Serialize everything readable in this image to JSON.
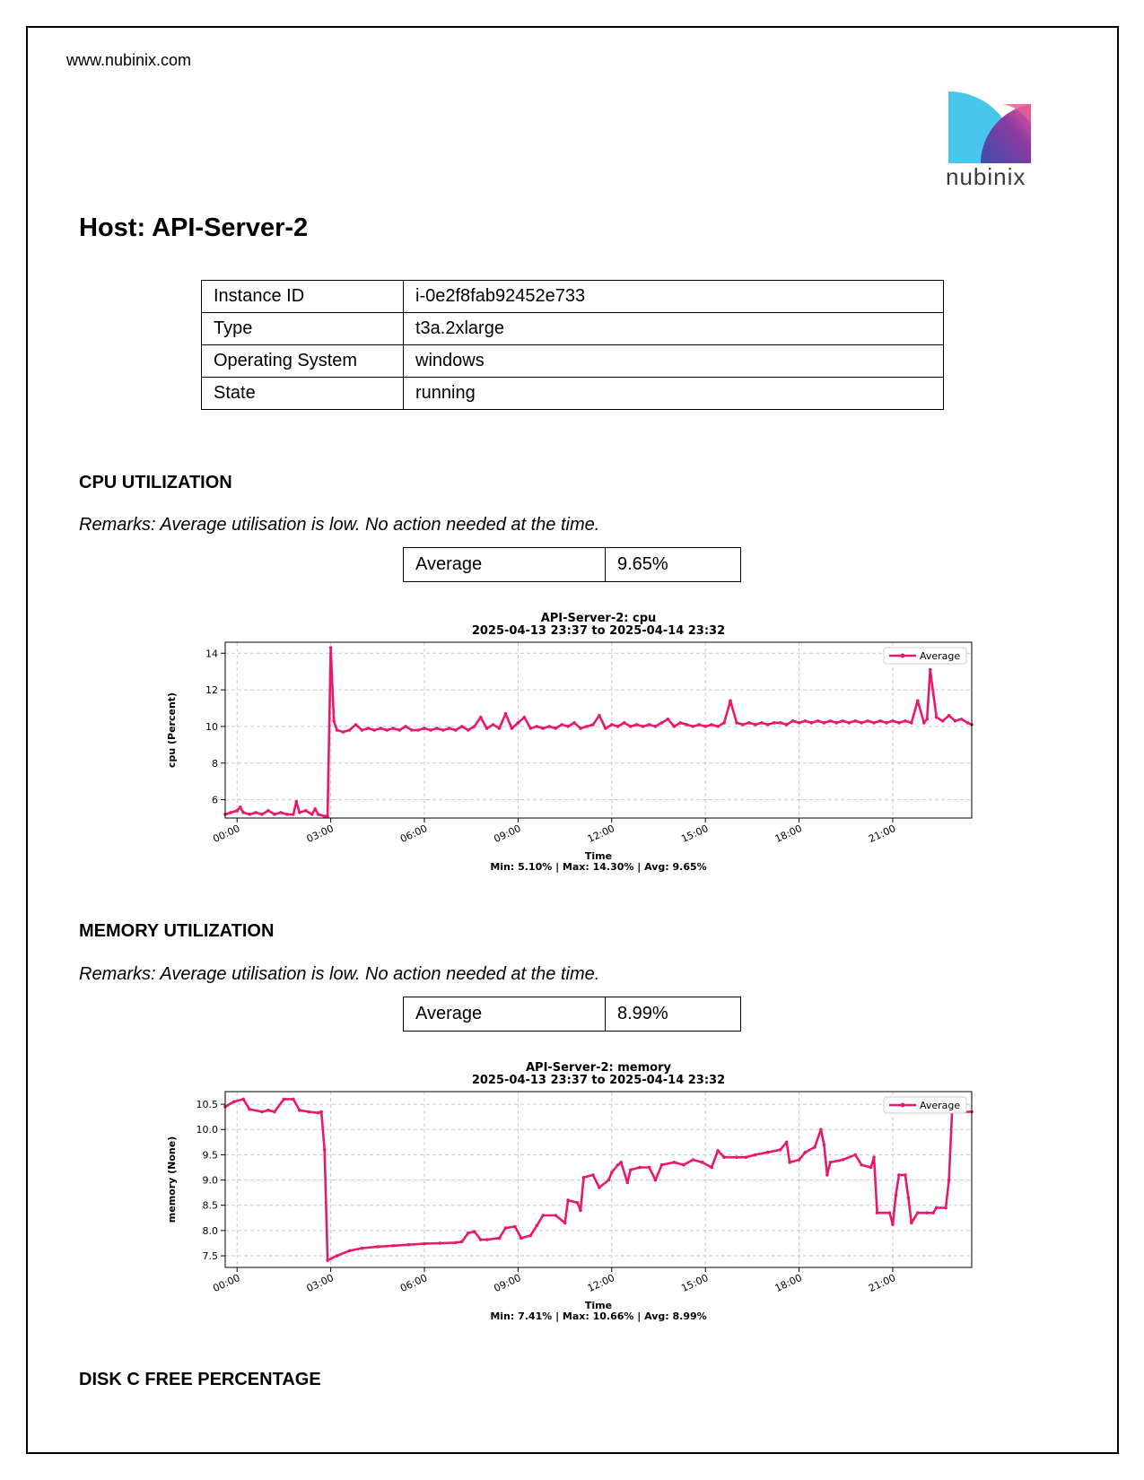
{
  "header": {
    "site": "www.nubinix.com",
    "logo_text": "nubinix"
  },
  "host": {
    "title": "Host: API-Server-2"
  },
  "info_table": [
    {
      "key": "Instance ID",
      "value": "i-0e2f8fab92452e733"
    },
    {
      "key": "Type",
      "value": "t3a.2xlarge"
    },
    {
      "key": "Operating System",
      "value": "windows"
    },
    {
      "key": "State",
      "value": "running"
    }
  ],
  "cpu": {
    "heading": "CPU UTILIZATION",
    "remarks": "Remarks: Average utilisation is low. No action needed at the time.",
    "avg_label": "Average",
    "avg_value": "9.65%"
  },
  "memory": {
    "heading": "MEMORY UTILIZATION",
    "remarks": "Remarks: Average utilisation is low. No action needed at the time.",
    "avg_label": "Average",
    "avg_value": "8.99%"
  },
  "disk": {
    "heading": "DISK C FREE PERCENTAGE"
  },
  "chart_data": [
    {
      "type": "line",
      "title": "API-Server-2: cpu",
      "subtitle": "2025-04-13 23:37 to 2025-04-14 23:32",
      "xlabel": "Time",
      "ylabel": "cpu (Percent)",
      "footer": "Min: 5.10% | Max: 14.30% | Avg: 9.65%",
      "x_ticks": [
        "00:00",
        "03:00",
        "06:00",
        "09:00",
        "12:00",
        "15:00",
        "18:00",
        "21:00"
      ],
      "y_ticks": [
        6,
        8,
        10,
        12,
        14
      ],
      "xlim": [
        -0.38,
        23.53
      ],
      "ylim": [
        5.0,
        14.6
      ],
      "grid": true,
      "legend_position": "top-right",
      "series": [
        {
          "name": "Average",
          "color": "#e8186d",
          "points": [
            [
              -0.38,
              5.2
            ],
            [
              -0.2,
              5.3
            ],
            [
              0.0,
              5.4
            ],
            [
              0.1,
              5.6
            ],
            [
              0.2,
              5.3
            ],
            [
              0.4,
              5.2
            ],
            [
              0.6,
              5.3
            ],
            [
              0.8,
              5.2
            ],
            [
              1.0,
              5.4
            ],
            [
              1.2,
              5.2
            ],
            [
              1.4,
              5.3
            ],
            [
              1.6,
              5.2
            ],
            [
              1.8,
              5.2
            ],
            [
              1.9,
              5.9
            ],
            [
              2.0,
              5.3
            ],
            [
              2.2,
              5.4
            ],
            [
              2.4,
              5.2
            ],
            [
              2.5,
              5.5
            ],
            [
              2.6,
              5.2
            ],
            [
              2.8,
              5.1
            ],
            [
              2.9,
              5.1
            ],
            [
              3.0,
              14.3
            ],
            [
              3.1,
              10.3
            ],
            [
              3.2,
              9.8
            ],
            [
              3.4,
              9.7
            ],
            [
              3.6,
              9.8
            ],
            [
              3.8,
              10.1
            ],
            [
              4.0,
              9.8
            ],
            [
              4.2,
              9.9
            ],
            [
              4.4,
              9.8
            ],
            [
              4.6,
              9.9
            ],
            [
              4.8,
              9.8
            ],
            [
              5.0,
              9.9
            ],
            [
              5.2,
              9.8
            ],
            [
              5.4,
              10.0
            ],
            [
              5.6,
              9.8
            ],
            [
              5.8,
              9.8
            ],
            [
              6.0,
              9.9
            ],
            [
              6.2,
              9.8
            ],
            [
              6.4,
              9.9
            ],
            [
              6.6,
              9.8
            ],
            [
              6.8,
              9.9
            ],
            [
              7.0,
              9.8
            ],
            [
              7.2,
              10.0
            ],
            [
              7.4,
              9.8
            ],
            [
              7.6,
              10.0
            ],
            [
              7.8,
              10.5
            ],
            [
              8.0,
              9.9
            ],
            [
              8.2,
              10.1
            ],
            [
              8.4,
              9.9
            ],
            [
              8.6,
              10.7
            ],
            [
              8.8,
              9.9
            ],
            [
              9.0,
              10.2
            ],
            [
              9.2,
              10.5
            ],
            [
              9.4,
              9.9
            ],
            [
              9.6,
              10.0
            ],
            [
              9.8,
              9.9
            ],
            [
              10.0,
              10.0
            ],
            [
              10.2,
              9.9
            ],
            [
              10.4,
              10.1
            ],
            [
              10.6,
              10.0
            ],
            [
              10.8,
              10.2
            ],
            [
              11.0,
              9.9
            ],
            [
              11.2,
              10.0
            ],
            [
              11.4,
              10.1
            ],
            [
              11.6,
              10.6
            ],
            [
              11.8,
              9.9
            ],
            [
              12.0,
              10.1
            ],
            [
              12.2,
              10.0
            ],
            [
              12.4,
              10.2
            ],
            [
              12.6,
              10.0
            ],
            [
              12.8,
              10.1
            ],
            [
              13.0,
              10.0
            ],
            [
              13.2,
              10.1
            ],
            [
              13.4,
              10.0
            ],
            [
              13.6,
              10.2
            ],
            [
              13.8,
              10.4
            ],
            [
              14.0,
              10.0
            ],
            [
              14.2,
              10.2
            ],
            [
              14.4,
              10.1
            ],
            [
              14.6,
              10.0
            ],
            [
              14.8,
              10.1
            ],
            [
              15.0,
              10.0
            ],
            [
              15.2,
              10.1
            ],
            [
              15.4,
              10.0
            ],
            [
              15.6,
              10.2
            ],
            [
              15.8,
              11.4
            ],
            [
              16.0,
              10.2
            ],
            [
              16.2,
              10.1
            ],
            [
              16.4,
              10.2
            ],
            [
              16.6,
              10.1
            ],
            [
              16.8,
              10.2
            ],
            [
              17.0,
              10.1
            ],
            [
              17.2,
              10.2
            ],
            [
              17.4,
              10.2
            ],
            [
              17.6,
              10.1
            ],
            [
              17.8,
              10.3
            ],
            [
              18.0,
              10.2
            ],
            [
              18.2,
              10.3
            ],
            [
              18.4,
              10.2
            ],
            [
              18.6,
              10.3
            ],
            [
              18.8,
              10.2
            ],
            [
              19.0,
              10.3
            ],
            [
              19.2,
              10.2
            ],
            [
              19.4,
              10.3
            ],
            [
              19.6,
              10.2
            ],
            [
              19.8,
              10.3
            ],
            [
              20.0,
              10.2
            ],
            [
              20.2,
              10.3
            ],
            [
              20.4,
              10.2
            ],
            [
              20.6,
              10.3
            ],
            [
              20.8,
              10.2
            ],
            [
              21.0,
              10.3
            ],
            [
              21.2,
              10.2
            ],
            [
              21.4,
              10.3
            ],
            [
              21.6,
              10.2
            ],
            [
              21.8,
              11.4
            ],
            [
              22.0,
              10.2
            ],
            [
              22.1,
              10.4
            ],
            [
              22.2,
              13.1
            ],
            [
              22.4,
              10.5
            ],
            [
              22.6,
              10.3
            ],
            [
              22.8,
              10.6
            ],
            [
              23.0,
              10.3
            ],
            [
              23.2,
              10.4
            ],
            [
              23.4,
              10.2
            ],
            [
              23.53,
              10.1
            ]
          ]
        }
      ]
    },
    {
      "type": "line",
      "title": "API-Server-2: memory",
      "subtitle": "2025-04-13 23:37 to 2025-04-14 23:32",
      "xlabel": "Time",
      "ylabel": "memory (None)",
      "footer": "Min: 7.41% | Max: 10.66% | Avg: 8.99%",
      "x_ticks": [
        "00:00",
        "03:00",
        "06:00",
        "09:00",
        "12:00",
        "15:00",
        "18:00",
        "21:00"
      ],
      "y_ticks": [
        7.5,
        8.0,
        8.5,
        9.0,
        9.5,
        10.0,
        10.5
      ],
      "xlim": [
        -0.38,
        23.53
      ],
      "ylim": [
        7.27,
        10.75
      ],
      "grid": true,
      "legend_position": "top-right",
      "series": [
        {
          "name": "Average",
          "color": "#e8186d",
          "points": [
            [
              -0.38,
              10.45
            ],
            [
              -0.1,
              10.55
            ],
            [
              0.2,
              10.6
            ],
            [
              0.4,
              10.4
            ],
            [
              0.8,
              10.35
            ],
            [
              1.0,
              10.38
            ],
            [
              1.2,
              10.35
            ],
            [
              1.5,
              10.6
            ],
            [
              1.8,
              10.6
            ],
            [
              2.0,
              10.38
            ],
            [
              2.3,
              10.35
            ],
            [
              2.6,
              10.33
            ],
            [
              2.7,
              10.35
            ],
            [
              2.8,
              9.6
            ],
            [
              2.9,
              7.41
            ],
            [
              3.2,
              7.5
            ],
            [
              3.6,
              7.6
            ],
            [
              4.0,
              7.65
            ],
            [
              4.5,
              7.68
            ],
            [
              5.0,
              7.7
            ],
            [
              5.5,
              7.72
            ],
            [
              6.0,
              7.74
            ],
            [
              6.5,
              7.75
            ],
            [
              7.0,
              7.76
            ],
            [
              7.2,
              7.78
            ],
            [
              7.4,
              7.95
            ],
            [
              7.6,
              7.98
            ],
            [
              7.8,
              7.82
            ],
            [
              8.0,
              7.82
            ],
            [
              8.4,
              7.85
            ],
            [
              8.6,
              8.05
            ],
            [
              8.9,
              8.08
            ],
            [
              9.1,
              7.85
            ],
            [
              9.4,
              7.9
            ],
            [
              9.6,
              8.1
            ],
            [
              9.8,
              8.3
            ],
            [
              10.2,
              8.3
            ],
            [
              10.5,
              8.15
            ],
            [
              10.6,
              8.6
            ],
            [
              10.9,
              8.55
            ],
            [
              11.0,
              8.4
            ],
            [
              11.1,
              9.05
            ],
            [
              11.4,
              9.1
            ],
            [
              11.6,
              8.85
            ],
            [
              11.9,
              9.0
            ],
            [
              12.0,
              9.15
            ],
            [
              12.2,
              9.3
            ],
            [
              12.3,
              9.35
            ],
            [
              12.5,
              8.95
            ],
            [
              12.6,
              9.2
            ],
            [
              12.9,
              9.25
            ],
            [
              13.2,
              9.25
            ],
            [
              13.4,
              9.0
            ],
            [
              13.6,
              9.3
            ],
            [
              14.0,
              9.35
            ],
            [
              14.3,
              9.3
            ],
            [
              14.6,
              9.4
            ],
            [
              14.9,
              9.35
            ],
            [
              15.2,
              9.25
            ],
            [
              15.4,
              9.58
            ],
            [
              15.6,
              9.45
            ],
            [
              16.0,
              9.45
            ],
            [
              16.3,
              9.45
            ],
            [
              16.6,
              9.5
            ],
            [
              17.0,
              9.55
            ],
            [
              17.4,
              9.6
            ],
            [
              17.6,
              9.75
            ],
            [
              17.7,
              9.35
            ],
            [
              18.0,
              9.4
            ],
            [
              18.2,
              9.55
            ],
            [
              18.5,
              9.65
            ],
            [
              18.7,
              10.0
            ],
            [
              18.8,
              9.7
            ],
            [
              18.9,
              9.1
            ],
            [
              19.0,
              9.35
            ],
            [
              19.4,
              9.4
            ],
            [
              19.8,
              9.5
            ],
            [
              20.0,
              9.3
            ],
            [
              20.3,
              9.25
            ],
            [
              20.4,
              9.45
            ],
            [
              20.5,
              8.35
            ],
            [
              20.9,
              8.35
            ],
            [
              21.0,
              8.12
            ],
            [
              21.1,
              8.7
            ],
            [
              21.2,
              9.1
            ],
            [
              21.4,
              9.1
            ],
            [
              21.5,
              8.65
            ],
            [
              21.6,
              8.15
            ],
            [
              21.8,
              8.35
            ],
            [
              22.1,
              8.35
            ],
            [
              22.3,
              8.35
            ],
            [
              22.4,
              8.45
            ],
            [
              22.7,
              8.45
            ],
            [
              22.8,
              9.0
            ],
            [
              22.9,
              10.35
            ],
            [
              23.2,
              10.35
            ],
            [
              23.53,
              10.35
            ]
          ]
        }
      ]
    }
  ]
}
